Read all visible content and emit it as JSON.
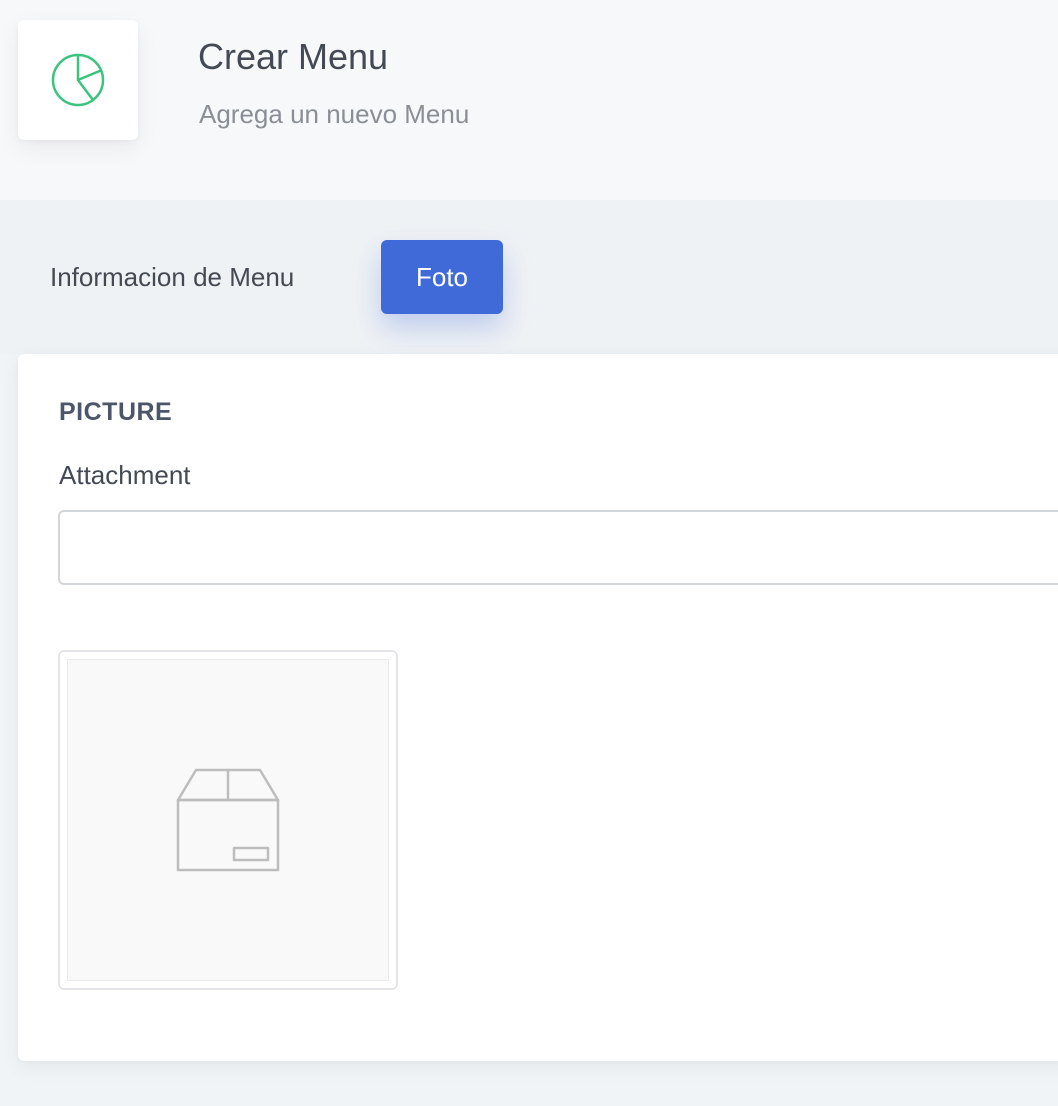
{
  "header": {
    "icon": "pie-chart-icon",
    "icon_color": "#3ac47d",
    "title": "Crear Menu",
    "subtitle": "Agrega un nuevo Menu"
  },
  "tabs": [
    {
      "label": "Informacion de Menu",
      "active": false
    },
    {
      "label": "Foto",
      "active": true
    }
  ],
  "accent_color": "#3f6ad8",
  "card": {
    "title": "PICTURE",
    "attachment": {
      "label": "Attachment",
      "value": "",
      "placeholder": ""
    },
    "preview": {
      "icon": "box-icon"
    }
  }
}
